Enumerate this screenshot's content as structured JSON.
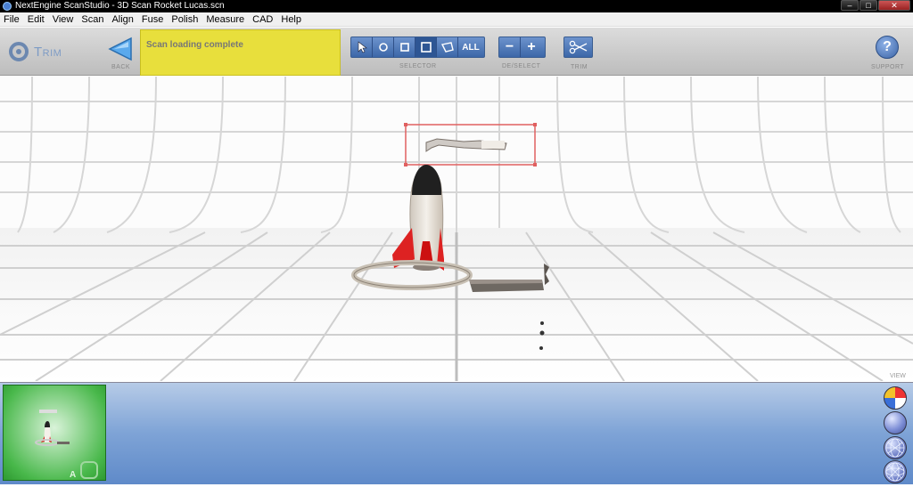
{
  "window": {
    "title": "NextEngine ScanStudio - 3D Scan Rocket Lucas.scn"
  },
  "menu": [
    "File",
    "Edit",
    "View",
    "Scan",
    "Align",
    "Fuse",
    "Polish",
    "Measure",
    "CAD",
    "Help"
  ],
  "toolbar": {
    "mode_title": "Trim",
    "back_caption": "Back",
    "status_message": "Scan loading complete",
    "selector_caption": "Selector",
    "selector_all": "ALL",
    "deselect_caption": "De/Select",
    "trim_caption": "Trim",
    "support_caption": "Support",
    "help_glyph": "?"
  },
  "viewport": {
    "view_label": "VIEW"
  },
  "thumbnail": {
    "label": "A"
  }
}
